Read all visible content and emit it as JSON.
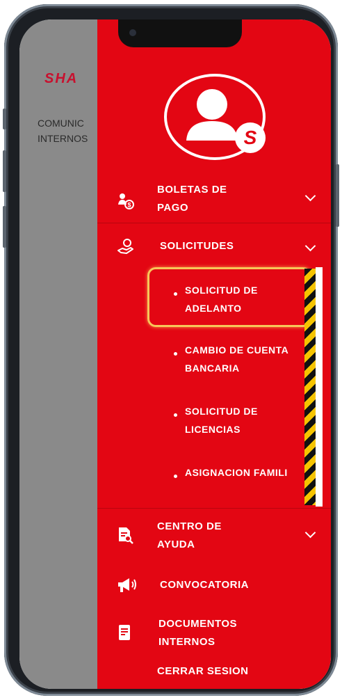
{
  "background_screen": {
    "logo_text": "SHA",
    "text_line1": "COMUNIC",
    "text_line2": "INTERNOS"
  },
  "drawer": {
    "badge_letter": "S",
    "menu": [
      {
        "label": "BOLETAS DE\nPAGO",
        "icon": "users-payment-icon",
        "expandable": true
      },
      {
        "label": "SOLICITUDES",
        "icon": "hand-money-icon",
        "expandable": true,
        "expanded": true,
        "children": [
          {
            "label": "SOLICITUD DE\nADELANTO",
            "selected": true
          },
          {
            "label": "CAMBIO DE CUENTA\nBANCARIA"
          },
          {
            "label": "SOLICITUD DE\nLICENCIAS"
          },
          {
            "label": "ASIGNACION FAMILI"
          }
        ]
      },
      {
        "label": "CENTRO DE\nAYUDA",
        "icon": "document-search-icon",
        "expandable": true
      },
      {
        "label": "CONVOCATORIA",
        "icon": "megaphone-icon",
        "expandable": false
      },
      {
        "label": "DOCUMENTOS\nINTERNOS",
        "icon": "document-icon",
        "expandable": false
      },
      {
        "label": "CERRAR SESION",
        "expandable": false
      }
    ]
  },
  "colors": {
    "drawer_red": "#e30613",
    "highlight": "#f7c65a",
    "backdrop_gray": "#8a8a8a"
  }
}
